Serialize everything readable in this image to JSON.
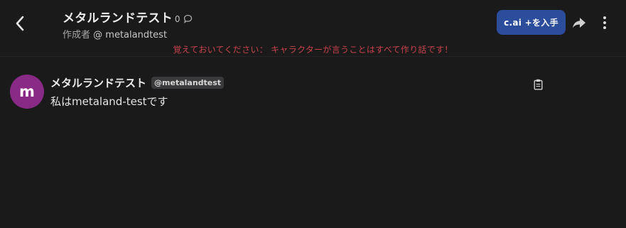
{
  "header": {
    "title": "メタルランドテスト",
    "chat_count": "0",
    "creator_label": "作成者",
    "creator_handle": "@ metalandtest",
    "get_button_label": "c.ai +を入手",
    "notice": "覚えておいてください： キャラクターが言うことはすべて作り話です！"
  },
  "icons": {
    "back": "chevron-left-icon",
    "chat": "chat-bubble-icon",
    "share": "share-icon",
    "more": "more-vertical-icon",
    "copy": "clipboard-icon"
  },
  "messages": [
    {
      "avatar_letter": "m",
      "name": "メタルランドテスト",
      "handle": "@metalandtest",
      "text": "私はmetaland-testです"
    }
  ],
  "colors": {
    "background": "#1a1a1b",
    "accent_button": "#2b4d9c",
    "notice_text": "#c7424b",
    "avatar_bg": "#8a2a87"
  }
}
